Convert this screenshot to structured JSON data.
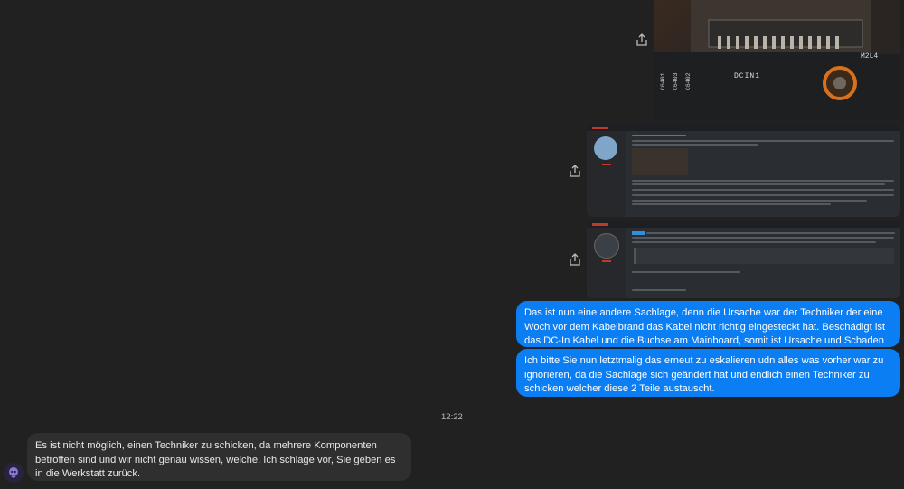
{
  "chat": {
    "messages_out": [
      "Das ist nun eine andere Sachlage, denn die Ursache war der Techniker der eine Woch vor dem Kabelbrand das Kabel nicht richtig eingesteckt hat. Beschädigt ist das DC-In Kabel und die Buchse am Mainboard, somit ist Ursache und Schaden klar.",
      "Ich bitte Sie nun letztmalig das erneut zu eskalieren udn alles was vorher war zu ignorieren, da die Sachlage sich geändert hat und endlich einen Techniker zu schicken welcher diese 2 Teile austauscht."
    ],
    "timestamp": "12:22",
    "message_in": "Es ist nicht möglich, einen Techniker zu schicken, da mehrere Komponenten betroffen sind und wir nicht genau wissen, welche. Ich schlage vor, Sie geben es in die Werkstatt zurück."
  },
  "photo": {
    "board_label": "DCIN1",
    "marking": "M2L4",
    "caps": [
      "C6401",
      "C6403",
      "C6402"
    ]
  },
  "icons": {
    "share": "share-icon",
    "assistant": "assistant-avatar-icon"
  },
  "colors": {
    "background": "#212121",
    "outgoing_bubble": "#0b7ef4",
    "incoming_bubble": "#2f2f2f"
  }
}
